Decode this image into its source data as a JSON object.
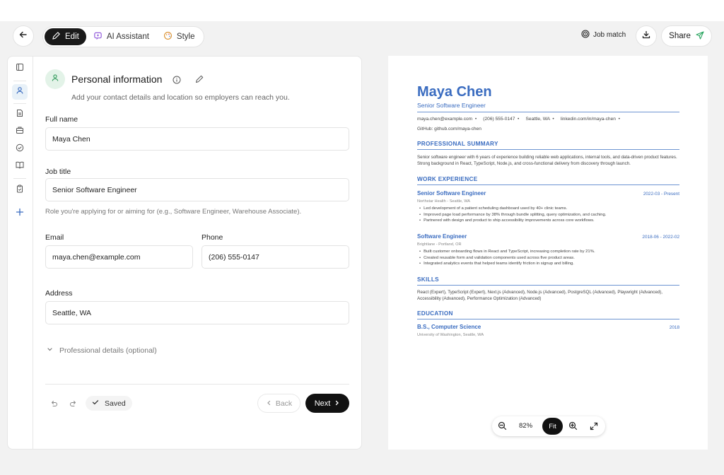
{
  "toolbar": {
    "modes": [
      {
        "label": "Edit",
        "icon": "pencil-icon",
        "active": true
      },
      {
        "label": "AI Assistant",
        "icon": "ai-sparkle-icon",
        "active": false
      },
      {
        "label": "Style",
        "icon": "palette-icon",
        "active": false
      }
    ],
    "job_match_label": "Job match",
    "share_label": "Share"
  },
  "sidebar": {
    "items": [
      {
        "icon": "sidebar-toggle-icon"
      },
      {
        "icon": "user-icon",
        "active": true
      },
      {
        "icon": "document-icon"
      },
      {
        "icon": "briefcase-icon"
      },
      {
        "icon": "check-circle-icon"
      },
      {
        "icon": "book-icon"
      },
      {
        "icon": "clipboard-icon"
      },
      {
        "icon": "plus-icon"
      }
    ]
  },
  "section": {
    "title": "Personal information",
    "subtitle": "Add your contact details and location so employers can reach you."
  },
  "form": {
    "full_name_label": "Full name",
    "full_name": "Maya Chen",
    "job_title_label": "Job title",
    "job_title": "Senior Software Engineer",
    "job_title_helper": "Role you're applying for or aiming for (e.g., Software Engineer, Warehouse Associate).",
    "email_label": "Email",
    "email": "maya.chen@example.com",
    "phone_label": "Phone",
    "phone": "(206) 555-0147",
    "address_label": "Address",
    "address": "Seattle, WA",
    "professional_details_label": "Professional details (optional)"
  },
  "footer": {
    "saved_label": "Saved",
    "back_label": "Back",
    "next_label": "Next"
  },
  "resume": {
    "name": "Maya Chen",
    "title": "Senior Software Engineer",
    "contact_line1": "maya.chen@example.com  •     (206) 555-0147  •     Seattle, WA  •     linkedin.com/in/maya-chen  •",
    "contact_line2": "GitHub: github.com/maya-chen",
    "summary_heading": "PROFESSIONAL SUMMARY",
    "summary": "Senior software engineer with 6 years of experience building reliable web applications, internal tools, and data-driven product features. Strong background in React, TypeScript, Node.js, and cross-functional delivery from discovery through launch.",
    "experience_heading": "WORK EXPERIENCE",
    "jobs": [
      {
        "title": "Senior Software Engineer",
        "dates": "2022-03 - Present",
        "company": "Northstar Health - Seattle, WA",
        "bullets": [
          "Led development of a patient scheduling dashboard used by 40+ clinic teams.",
          "Improved page load performance by 38% through bundle splitting, query optimization, and caching.",
          "Partnered with design and product to ship accessibility improvements across core workflows."
        ]
      },
      {
        "title": "Software Engineer",
        "dates": "2018-06 - 2022-02",
        "company": "Brightlane - Portland, OR",
        "bullets": [
          "Built customer onboarding flows in React and TypeScript, increasing completion rate by 21%.",
          "Created reusable form and validation components used across five product areas.",
          "Integrated analytics events that helped teams identify friction in signup and billing."
        ]
      }
    ],
    "skills_heading": "SKILLS",
    "skills": "React (Expert), TypeScript (Expert), Next.js (Advanced), Node.js (Advanced), PostgreSQL (Advanced), Playwright (Advanced), Accessibility (Advanced), Performance Optimization (Advanced)",
    "education_heading": "EDUCATION",
    "degree": "B.S., Computer Science",
    "degree_year": "2018",
    "school": "University of Washington, Seattle, WA"
  },
  "zoom": {
    "percent": "82%",
    "fit_label": "Fit"
  },
  "colors": {
    "accent": "#3a6cc0",
    "primary_button": "#111111",
    "section_icon_bg": "#e3f3e8"
  }
}
